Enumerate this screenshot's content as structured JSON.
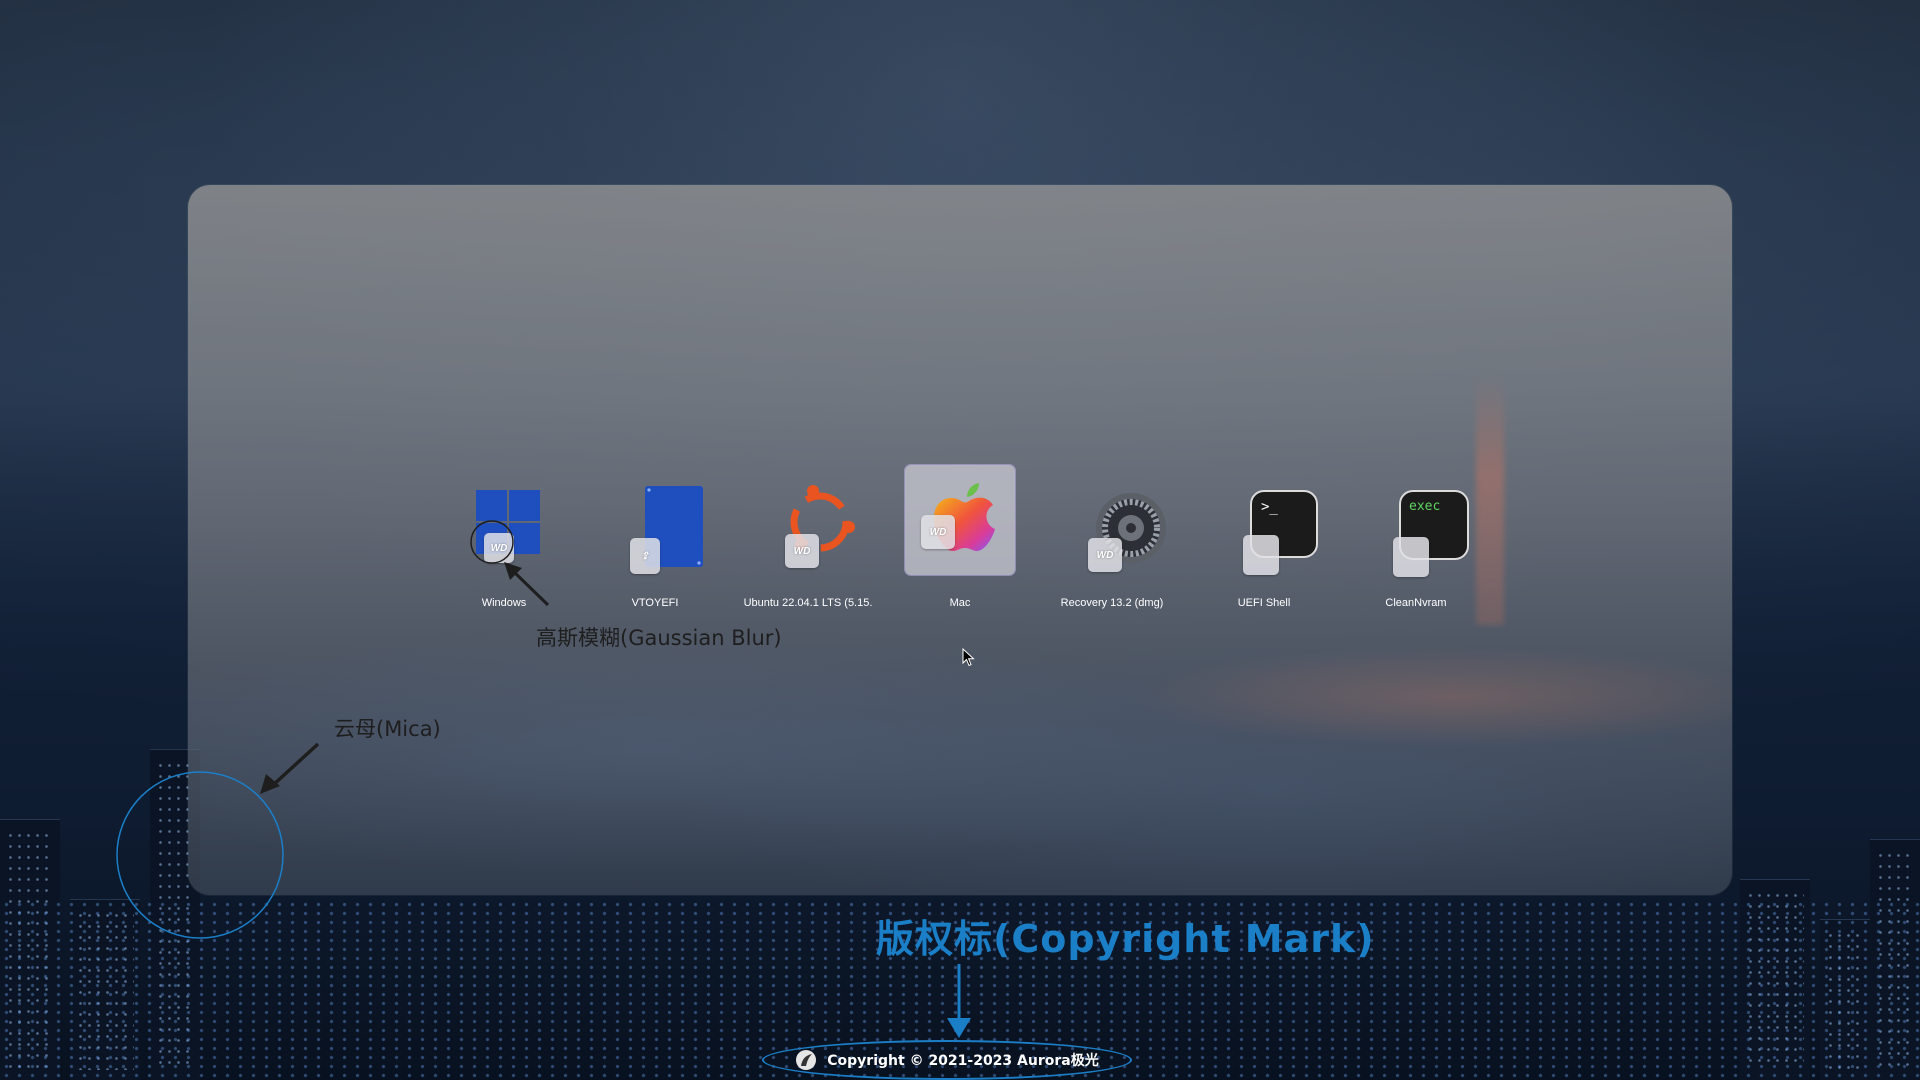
{
  "boot_entries": [
    {
      "label": "Windows",
      "icon": "windows-icon"
    },
    {
      "label": "VTOYEFI",
      "icon": "usb-drive-icon"
    },
    {
      "label": "Ubuntu 22.04.1 LTS (5.15.",
      "icon": "ubuntu-icon"
    },
    {
      "label": "Mac",
      "icon": "apple-icon",
      "selected": true
    },
    {
      "label": "Recovery 13.2 (dmg)",
      "icon": "gear-icon"
    },
    {
      "label": "UEFI Shell",
      "icon": "terminal-icon"
    },
    {
      "label": "CleanNvram",
      "icon": "exec-icon"
    }
  ],
  "drive_badge": "WD",
  "exec_text": "exec",
  "shell_prompt": ">_",
  "annotations": {
    "gaussian_blur": "高斯模糊(Gaussian Blur)",
    "mica": "云母(Mica)",
    "copyright_mark": "版权标(Copyright Mark)"
  },
  "copyright": "Copyright © 2021-2023 Aurora极光",
  "colors": {
    "accent_blue": "#1b7fc8",
    "windows_blue": "#1f4fbf",
    "ubuntu_orange": "#e95420",
    "annotation_text": "#1e1e1e"
  }
}
